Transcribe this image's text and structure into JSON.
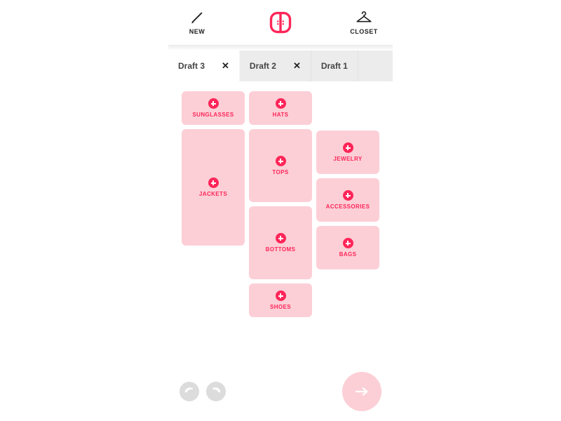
{
  "header": {
    "new_label": "NEW",
    "closet_label": "CLOSET"
  },
  "tabs": [
    {
      "label": "Draft 3",
      "active": true,
      "closable": true
    },
    {
      "label": "Draft 2",
      "active": false,
      "closable": true
    },
    {
      "label": "Draft 1",
      "active": false,
      "closable": false
    }
  ],
  "categories": {
    "sunglasses": "SUNGLASSES",
    "hats": "HATS",
    "jackets": "JACKETS",
    "tops": "TOPS",
    "jewelry": "JEWELRY",
    "accessories": "ACCESSORIES",
    "bottoms": "BOTTOMS",
    "bags": "BAGS",
    "shoes": "SHOES"
  },
  "colors": {
    "accent": "#ff2558",
    "card_bg": "#fccfd6",
    "tab_bg": "#ececec",
    "disabled": "#dcdcdc"
  }
}
